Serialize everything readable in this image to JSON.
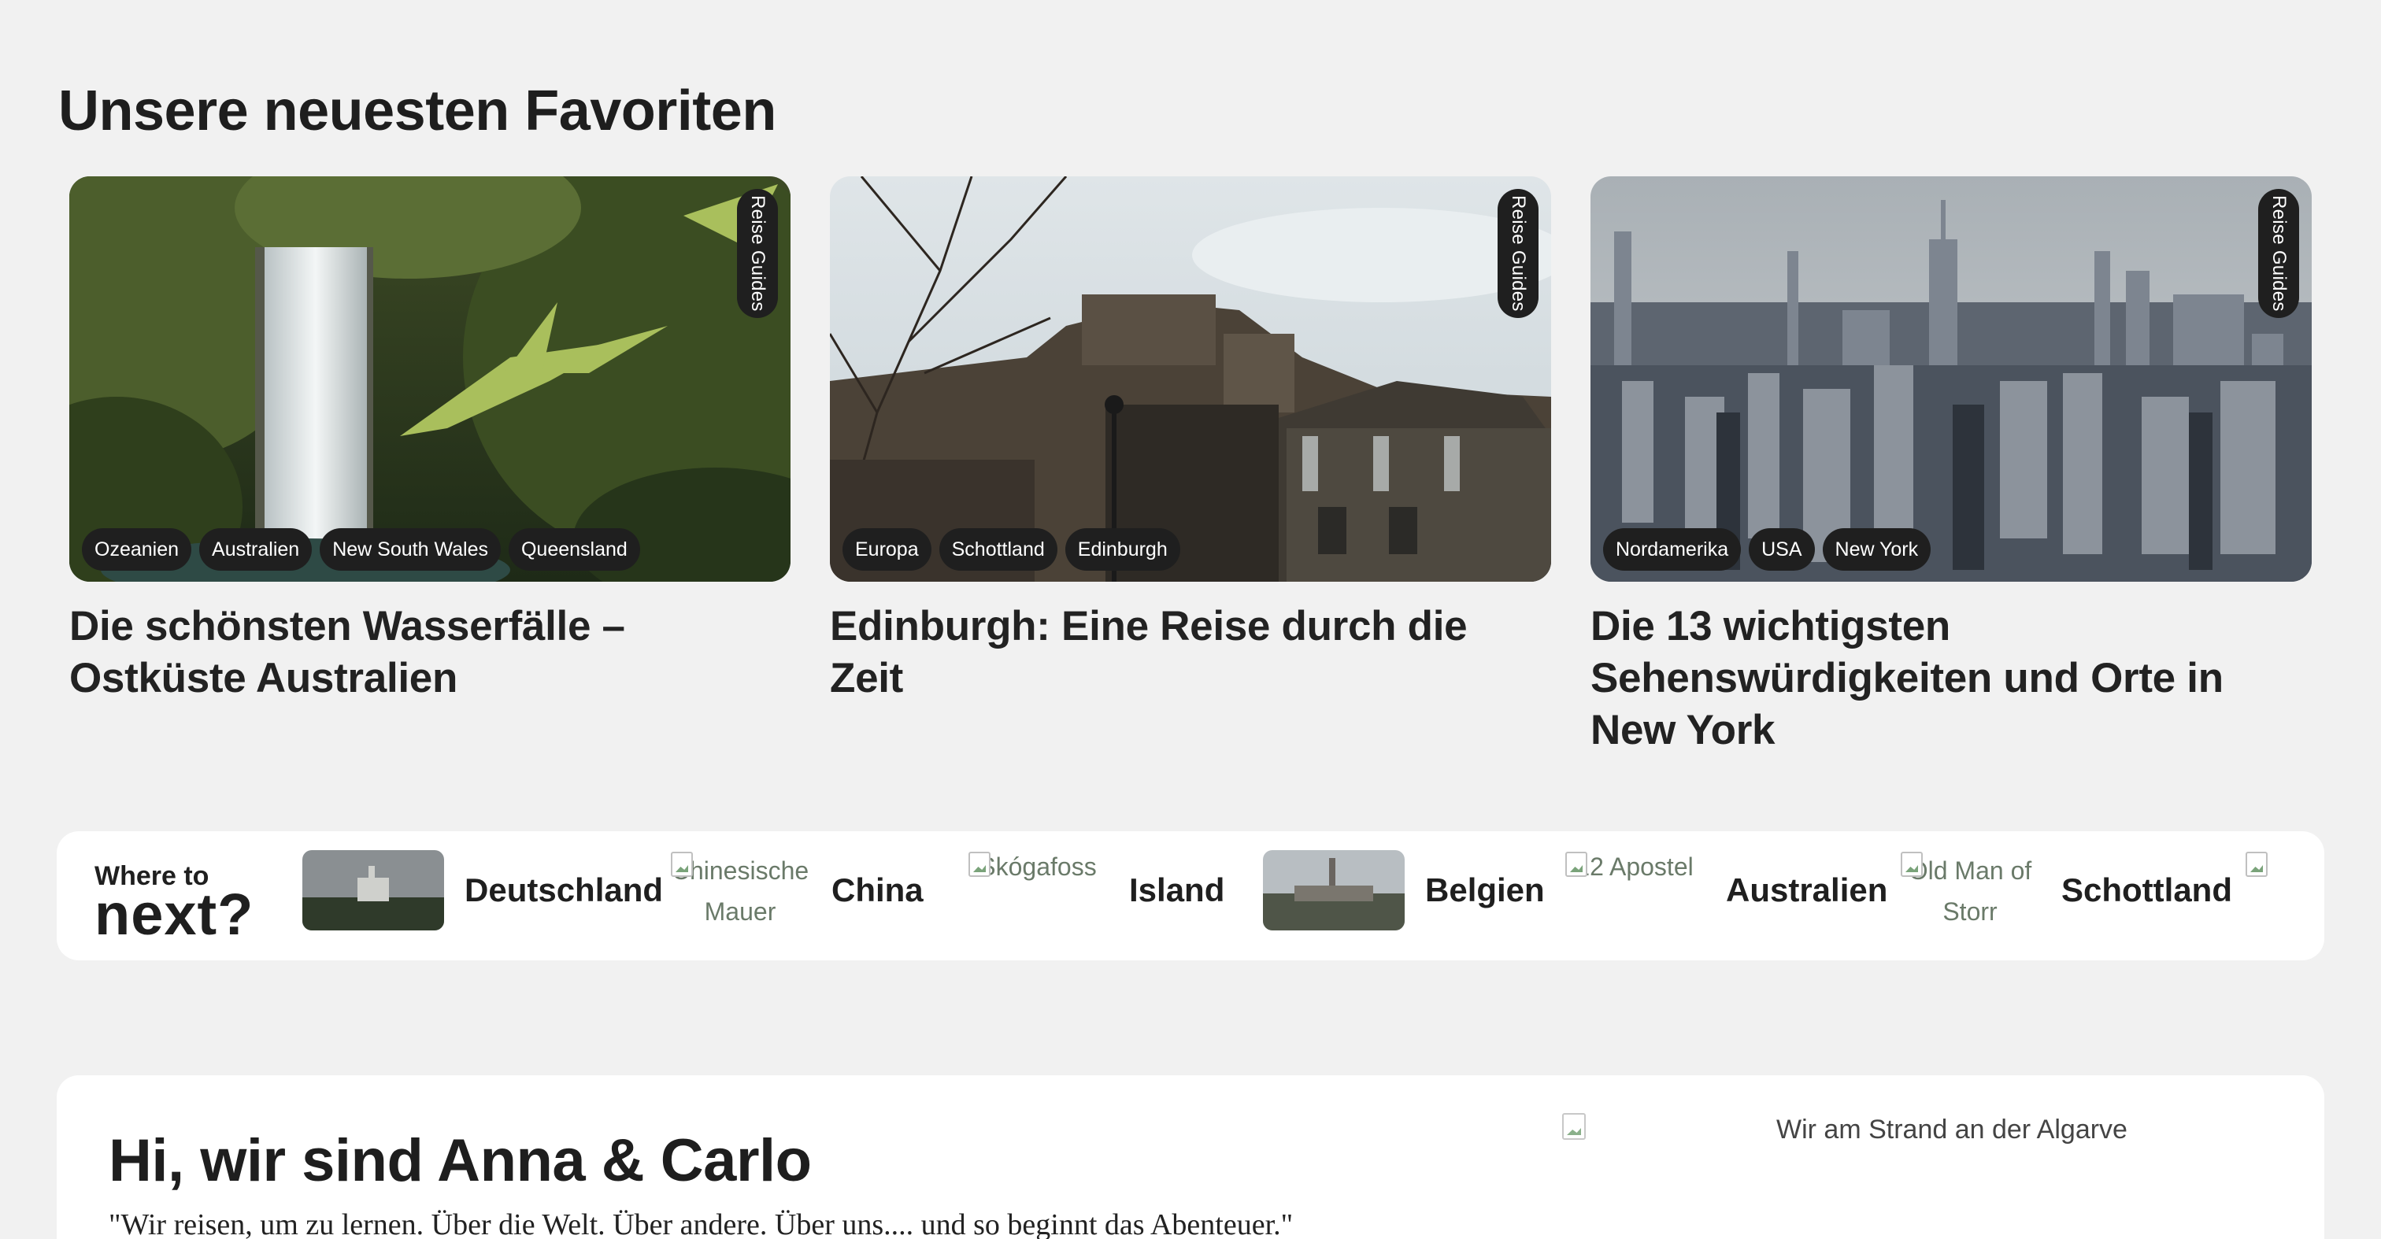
{
  "section_title": "Unsere neuesten Favoriten",
  "cards": [
    {
      "badge": "Reise Guides",
      "tags": [
        "Ozeanien",
        "Australien",
        "New South Wales",
        "Queensland"
      ],
      "title": "Die schönsten Wasserfälle – Ostküste Australien"
    },
    {
      "badge": "Reise Guides",
      "tags": [
        "Europa",
        "Schottland",
        "Edinburgh"
      ],
      "title": "Edinburgh: Eine Reise durch die Zeit"
    },
    {
      "badge": "Reise Guides",
      "tags": [
        "Nordamerika",
        "USA",
        "New York"
      ],
      "title": "Die 13 wichtigsten Sehenswürdigkeiten und Orte in New York"
    }
  ],
  "where_to": {
    "line1": "Where to",
    "line2": "next?",
    "destinations": [
      {
        "name": "Deutschland"
      },
      {
        "name": "China",
        "alt": "Chinesische Mauer"
      },
      {
        "name": "Island",
        "alt": "Skógafoss"
      },
      {
        "name": "Belgien"
      },
      {
        "name": "Australien",
        "alt": "12 Apostel"
      },
      {
        "name": "Schottland",
        "alt": "Old Man of Storr"
      }
    ]
  },
  "about": {
    "heading": "Hi, wir sind Anna & Carlo",
    "quote": "\"Wir reisen, um zu lernen. Über die Welt. Über andere. Über uns.... und so beginnt das Abenteuer.\"",
    "photo_alt": "Wir am Strand an der Algarve"
  },
  "colors": {
    "background": "#f1f1f1",
    "panel": "#ffffff",
    "tag_bg": "#1f1f1f",
    "text": "#1e1e1e"
  }
}
